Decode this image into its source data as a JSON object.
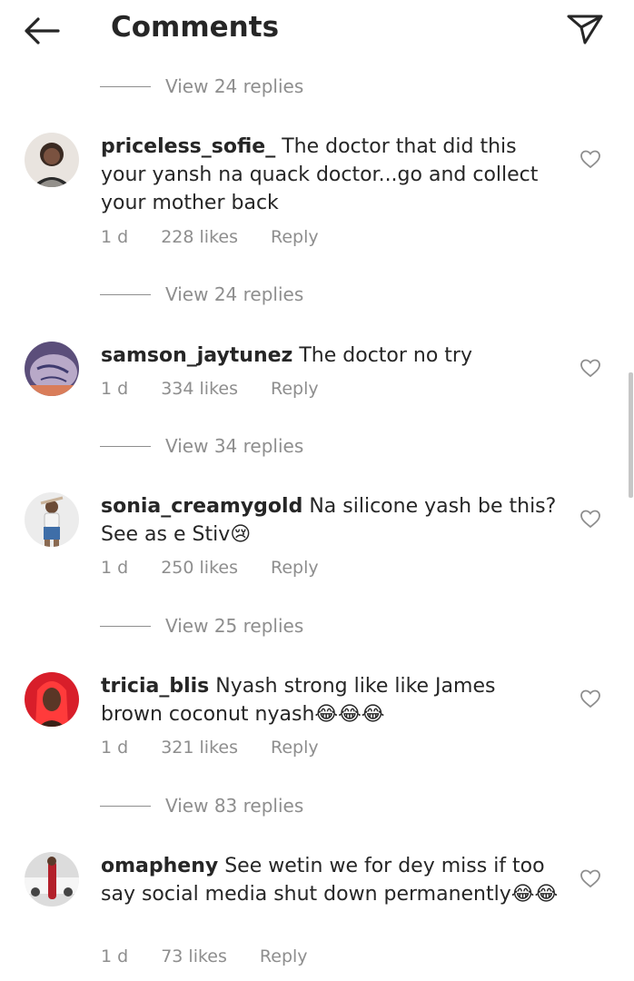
{
  "header": {
    "title": "Comments"
  },
  "first_view_replies": "View 24 replies",
  "comments": [
    {
      "username": "priceless_sofie_",
      "text": "The doctor that did this your yansh na quack doctor...go and collect your mother back",
      "time": "1 d",
      "likes": "228 likes",
      "reply": "Reply",
      "view_replies": "View 24 replies"
    },
    {
      "username": "samson_jaytunez",
      "text": "The doctor no try",
      "time": "1 d",
      "likes": "334 likes",
      "reply": "Reply",
      "view_replies": "View 34 replies"
    },
    {
      "username": "sonia_creamygold",
      "text": "Na silicone yash be this? See as e Stiv😢",
      "time": "1 d",
      "likes": "250 likes",
      "reply": "Reply",
      "view_replies": "View 25 replies"
    },
    {
      "username": "tricia_blis",
      "text": "Nyash strong like like James brown coconut nyash😂😂😂",
      "time": "1 d",
      "likes": "321 likes",
      "reply": "Reply",
      "view_replies": "View 83 replies"
    },
    {
      "username": "omapheny",
      "text": "See wetin we for dey miss if too say social media shut down permanently😂😂",
      "time": "1 d",
      "likes": "73 likes",
      "reply": "Reply"
    }
  ],
  "icons": {
    "back": "back-arrow-icon",
    "send": "direct-send-icon",
    "like": "heart-outline-icon"
  },
  "colors": {
    "text": "#262626",
    "muted": "#8e8e8e",
    "background": "#ffffff"
  }
}
